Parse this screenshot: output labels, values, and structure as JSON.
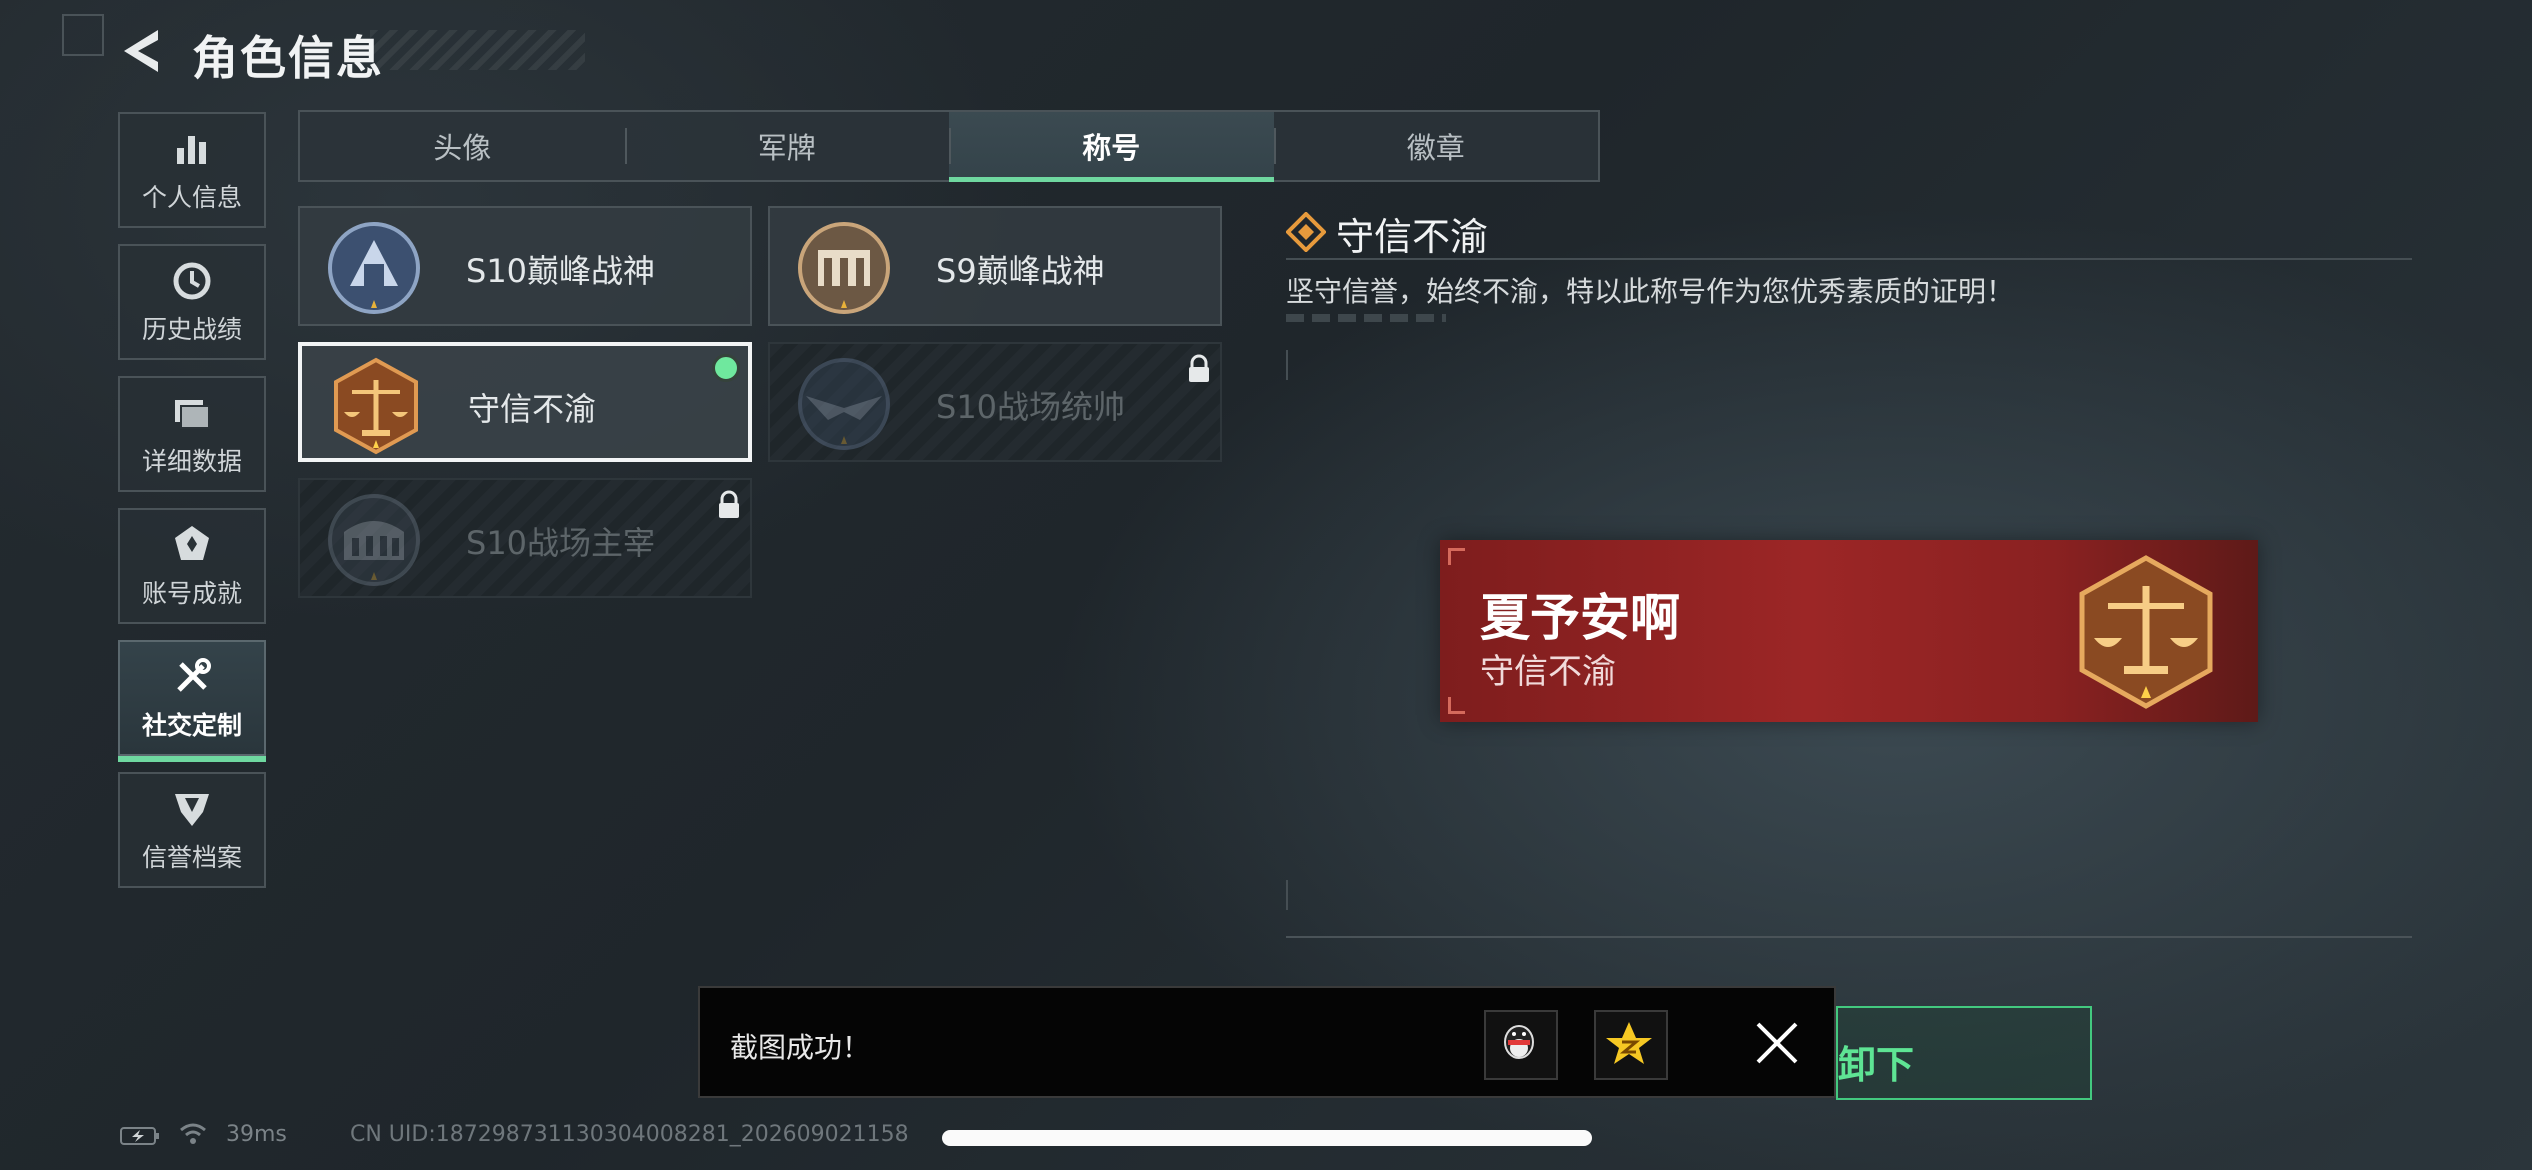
{
  "header": {
    "title": "角色信息"
  },
  "sidebar": {
    "items": [
      {
        "label": "个人信息",
        "icon": "bar-chart-icon"
      },
      {
        "label": "历史战绩",
        "icon": "clock-icon"
      },
      {
        "label": "详细数据",
        "icon": "folder-icon"
      },
      {
        "label": "账号成就",
        "icon": "achievement-icon"
      },
      {
        "label": "社交定制",
        "icon": "tools-icon",
        "active": true
      },
      {
        "label": "信誉档案",
        "icon": "emblem-icon"
      }
    ]
  },
  "tabs": [
    {
      "label": "头像"
    },
    {
      "label": "军牌"
    },
    {
      "label": "称号",
      "active": true
    },
    {
      "label": "徽章"
    }
  ],
  "titles": [
    {
      "name": "S10巅峰战神",
      "state": "unlocked",
      "icon": "blue-medal-icon"
    },
    {
      "name": "S9巅峰战神",
      "state": "unlocked",
      "icon": "bronze-medal-icon"
    },
    {
      "name": "守信不渝",
      "state": "selected-equipped",
      "icon": "scales-medal-icon"
    },
    {
      "name": "S10战场统帅",
      "state": "locked",
      "icon": "eagle-medal-icon"
    },
    {
      "name": "S10战场主宰",
      "state": "locked",
      "icon": "colosseum-medal-icon"
    }
  ],
  "detail": {
    "title": "守信不渝",
    "description": "坚守信誉，始终不渝，特以此称号作为您优秀素质的证明！"
  },
  "preview": {
    "player_name": "夏予安啊",
    "title_text": "守信不渝"
  },
  "toast": {
    "message": "截图成功！",
    "share_targets": [
      "qq-icon",
      "qzone-icon"
    ]
  },
  "confirm_button": {
    "visible_label": "卸下"
  },
  "status": {
    "ping": "39ms",
    "uid": "CN UID:1872987311303040082​81_202609021158"
  },
  "colors": {
    "accent_green": "#6fd8a0",
    "card_red": "#9c2626",
    "background": "#242b30"
  }
}
